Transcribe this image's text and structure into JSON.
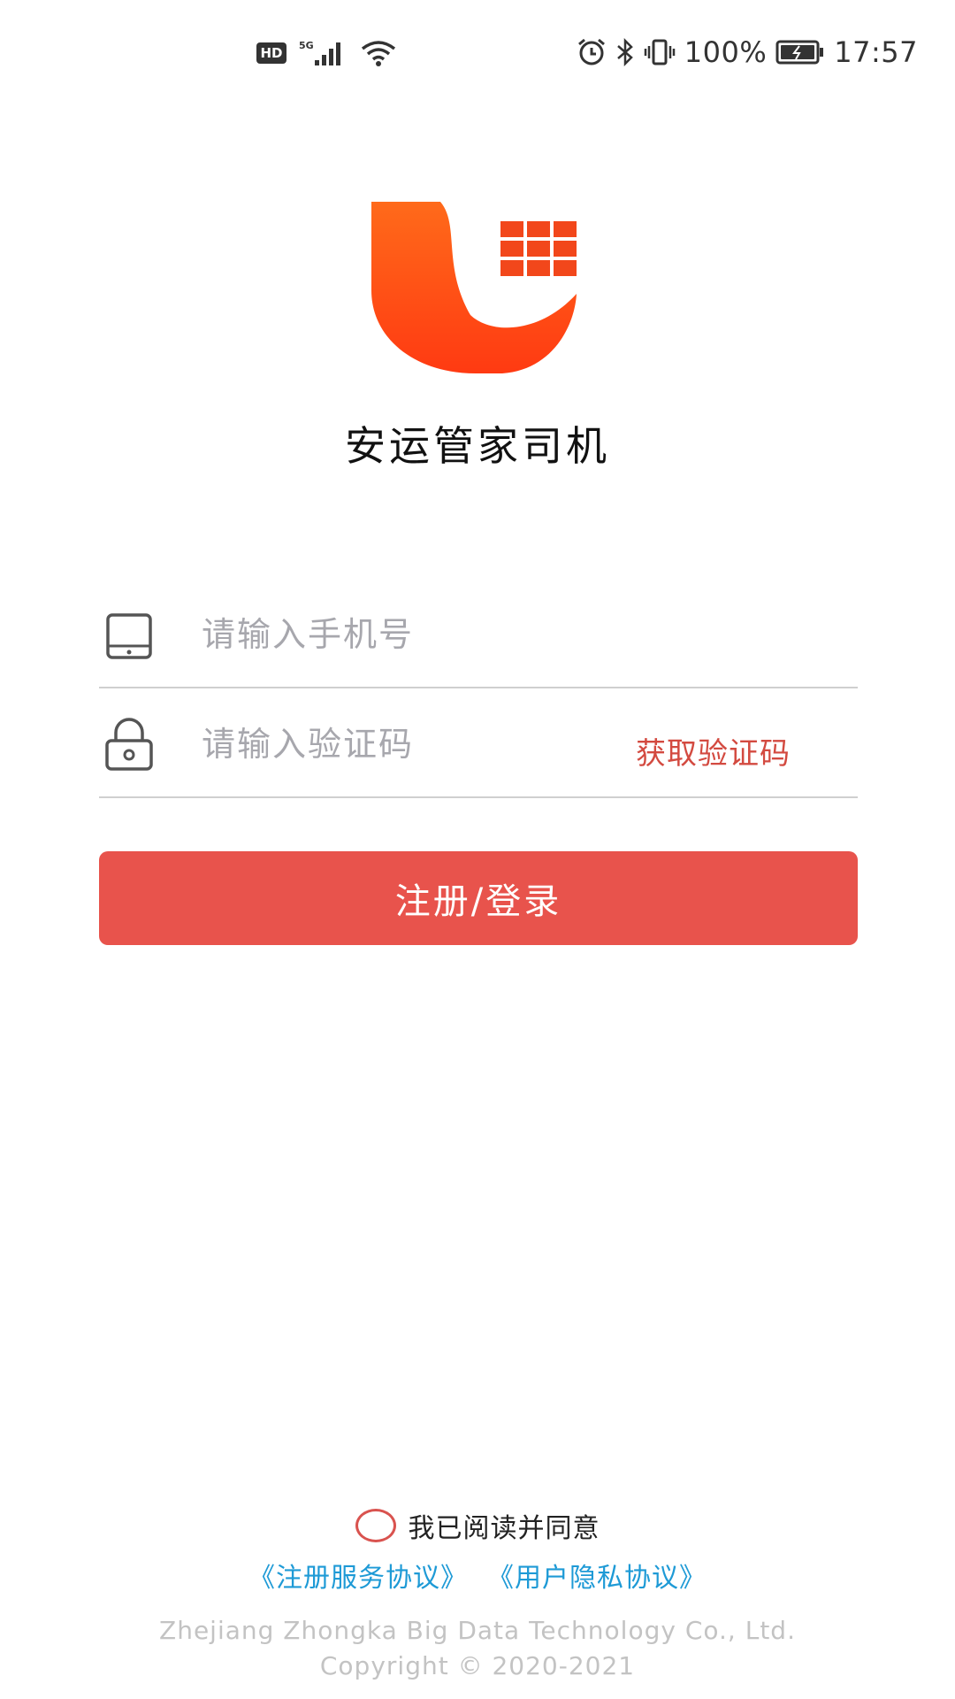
{
  "status_bar": {
    "network_badge": "HD",
    "network_type": "5G",
    "icons": [
      "signal-icon",
      "wifi-icon",
      "alarm-icon",
      "bluetooth-icon",
      "vibrate-icon",
      "battery-icon"
    ],
    "battery": "100%",
    "time": "17:57"
  },
  "app": {
    "title": "安运管家司机",
    "brand_colors": {
      "logo_top": "#ff6a1a",
      "logo_bottom": "#ff3a12",
      "grid": "#f2471b"
    }
  },
  "form": {
    "phone": {
      "icon": "phone-device-icon",
      "placeholder": "请输入手机号",
      "value": ""
    },
    "code": {
      "icon": "lock-icon",
      "placeholder": "请输入验证码",
      "value": "",
      "get_code_label": "获取验证码"
    },
    "submit_label": "注册/登录",
    "accent_color": "#e8534c"
  },
  "agreement": {
    "checked": false,
    "text": "我已阅读并同意",
    "service_link": "《注册服务协议》",
    "privacy_link": "《用户隐私协议》"
  },
  "footer": {
    "company": "Zhejiang Zhongka Big Data Technology Co., Ltd.",
    "copyright": "Copyright © 2020-2021"
  }
}
